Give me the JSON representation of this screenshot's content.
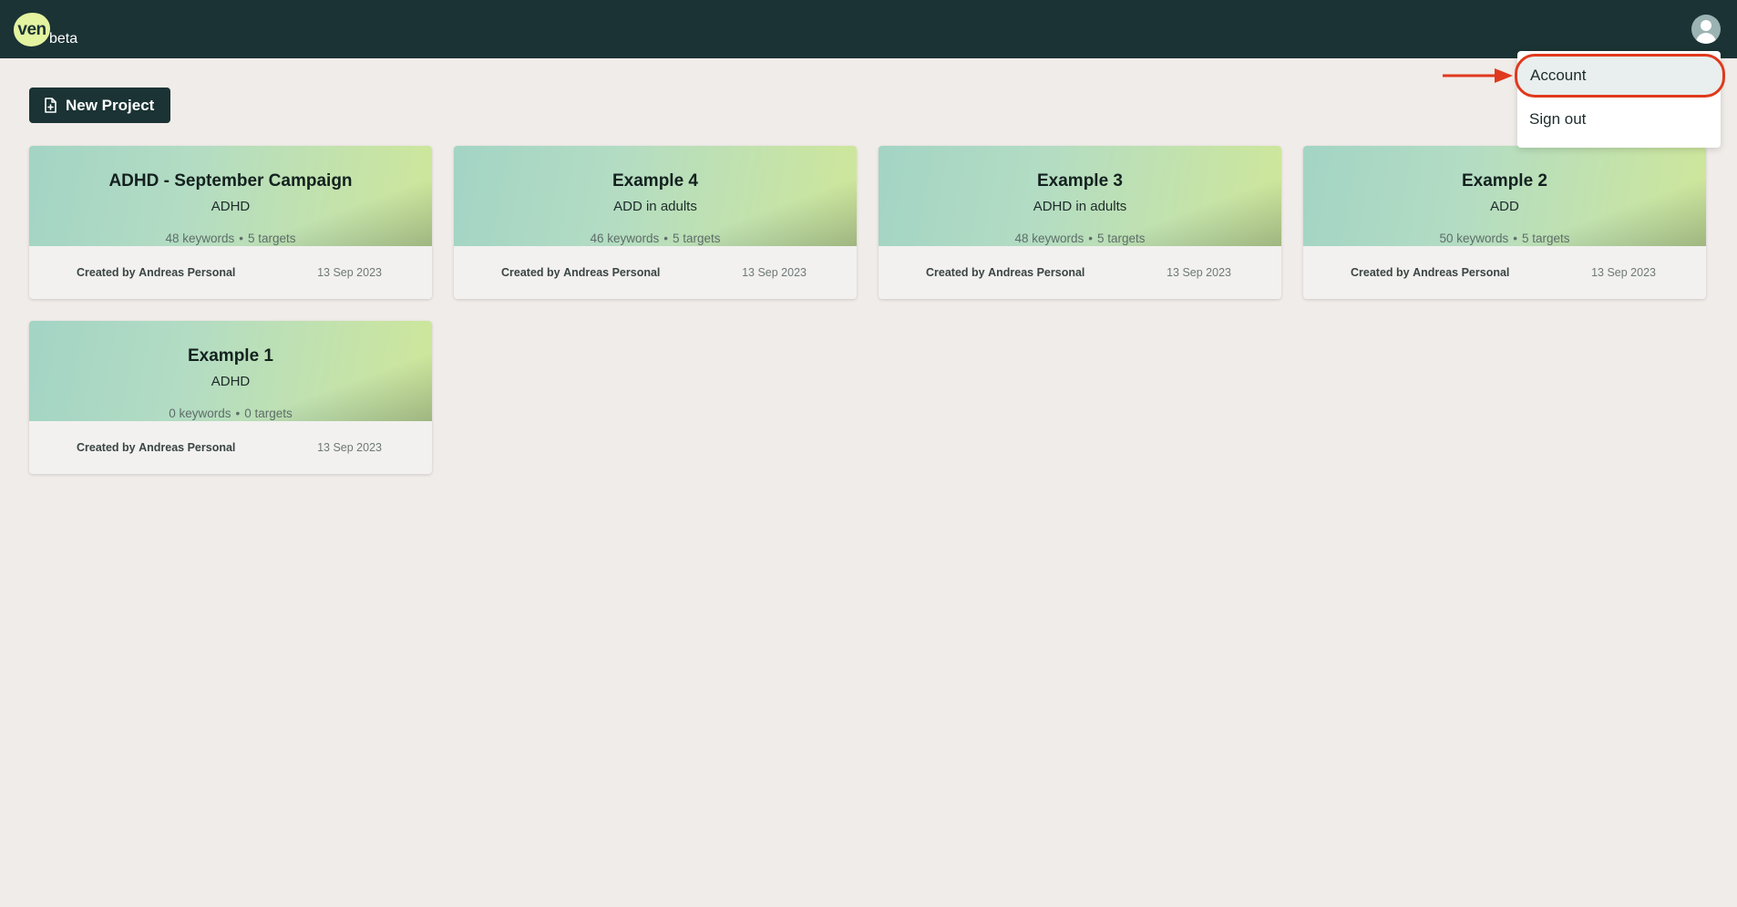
{
  "header": {
    "logo_text": "ven",
    "badge": "beta",
    "avatar_icon": "user-icon"
  },
  "toolbar": {
    "new_project_label": "New Project",
    "new_project_icon": "file-plus-icon"
  },
  "projects": [
    {
      "title": "ADHD - September Campaign",
      "subtitle": "ADHD",
      "keywords": "48 keywords",
      "targets": "5 targets",
      "created_by_label": "Created by",
      "creator": "Andreas Personal",
      "date": "13 Sep 2023"
    },
    {
      "title": "Example 4",
      "subtitle": "ADD in adults",
      "keywords": "46 keywords",
      "targets": "5 targets",
      "created_by_label": "Created by",
      "creator": "Andreas Personal",
      "date": "13 Sep 2023"
    },
    {
      "title": "Example 3",
      "subtitle": "ADHD in adults",
      "keywords": "48 keywords",
      "targets": "5 targets",
      "created_by_label": "Created by",
      "creator": "Andreas Personal",
      "date": "13 Sep 2023"
    },
    {
      "title": "Example 2",
      "subtitle": "ADD",
      "keywords": "50 keywords",
      "targets": "5 targets",
      "created_by_label": "Created by",
      "creator": "Andreas Personal",
      "date": "13 Sep 2023"
    },
    {
      "title": "Example 1",
      "subtitle": "ADHD",
      "keywords": "0 keywords",
      "targets": "0 targets",
      "created_by_label": "Created by",
      "creator": "Andreas Personal",
      "date": "13 Sep 2023"
    }
  ],
  "meta_separator": "•",
  "user_menu": {
    "items": [
      {
        "label": "Account"
      },
      {
        "label": "Sign out"
      }
    ]
  },
  "colors": {
    "topbar": "#1b3334",
    "background": "#f0ece9",
    "highlight": "#e0391d",
    "logo": "#e4f3a0"
  }
}
